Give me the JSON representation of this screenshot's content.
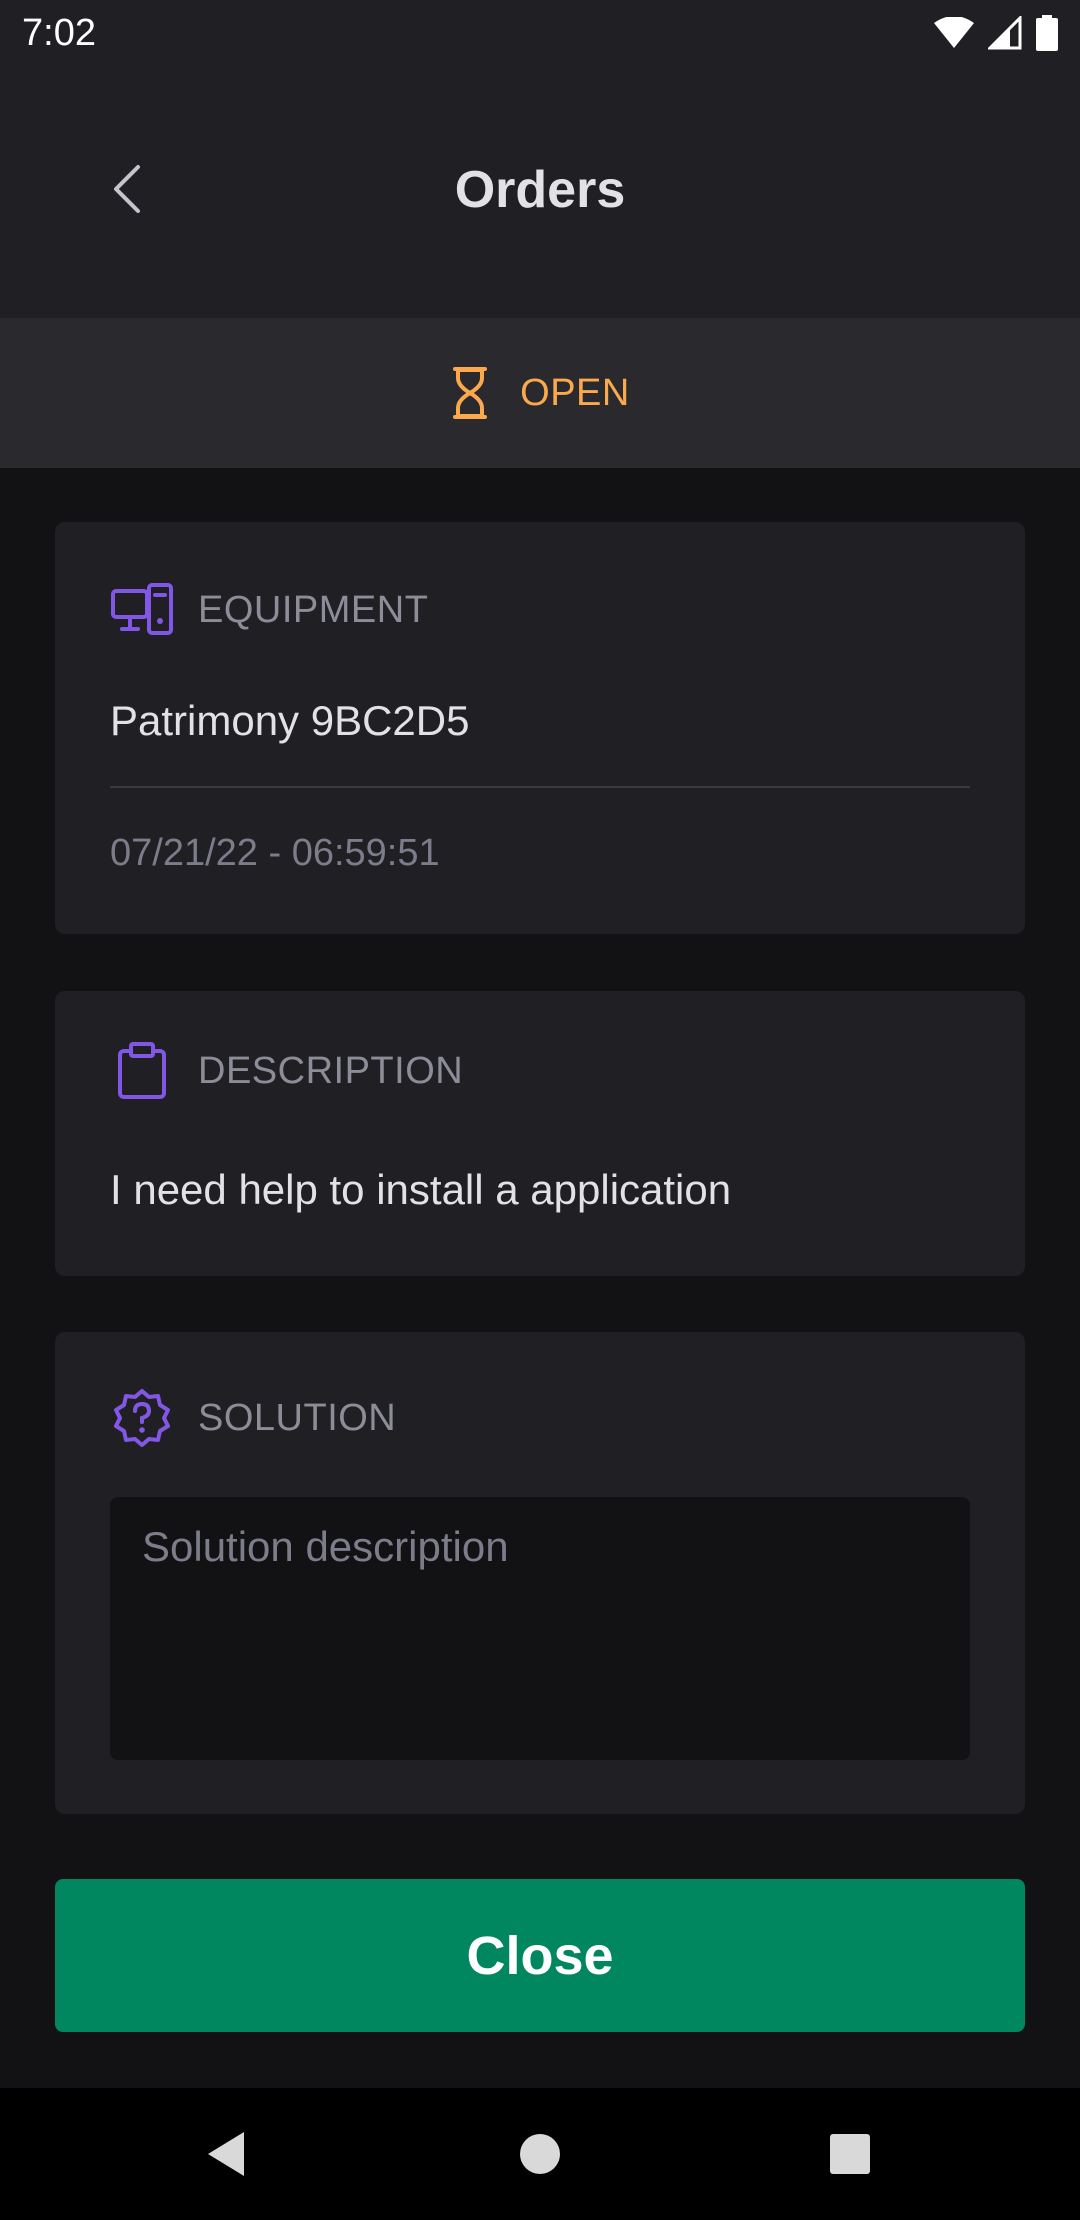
{
  "status_bar": {
    "time": "7:02"
  },
  "header": {
    "title": "Orders",
    "back_icon": "chevron-left-icon"
  },
  "order_status": {
    "label": "OPEN",
    "icon": "hourglass-icon",
    "color": "#fba94c"
  },
  "equipment": {
    "label": "EQUIPMENT",
    "icon": "desktop-computer-icon",
    "value": "Patrimony 9BC2D5",
    "timestamp": "07/21/22 - 06:59:51"
  },
  "description": {
    "label": "DESCRIPTION",
    "icon": "clipboard-icon",
    "value": "I need help to install a application"
  },
  "solution": {
    "label": "SOLUTION",
    "icon": "help-badge-icon",
    "placeholder": "Solution description",
    "value": ""
  },
  "actions": {
    "close_label": "Close",
    "close_color": "#00875f"
  },
  "colors": {
    "accent_icon": "#8257e5",
    "background": "#121214",
    "surface": "#202024"
  }
}
